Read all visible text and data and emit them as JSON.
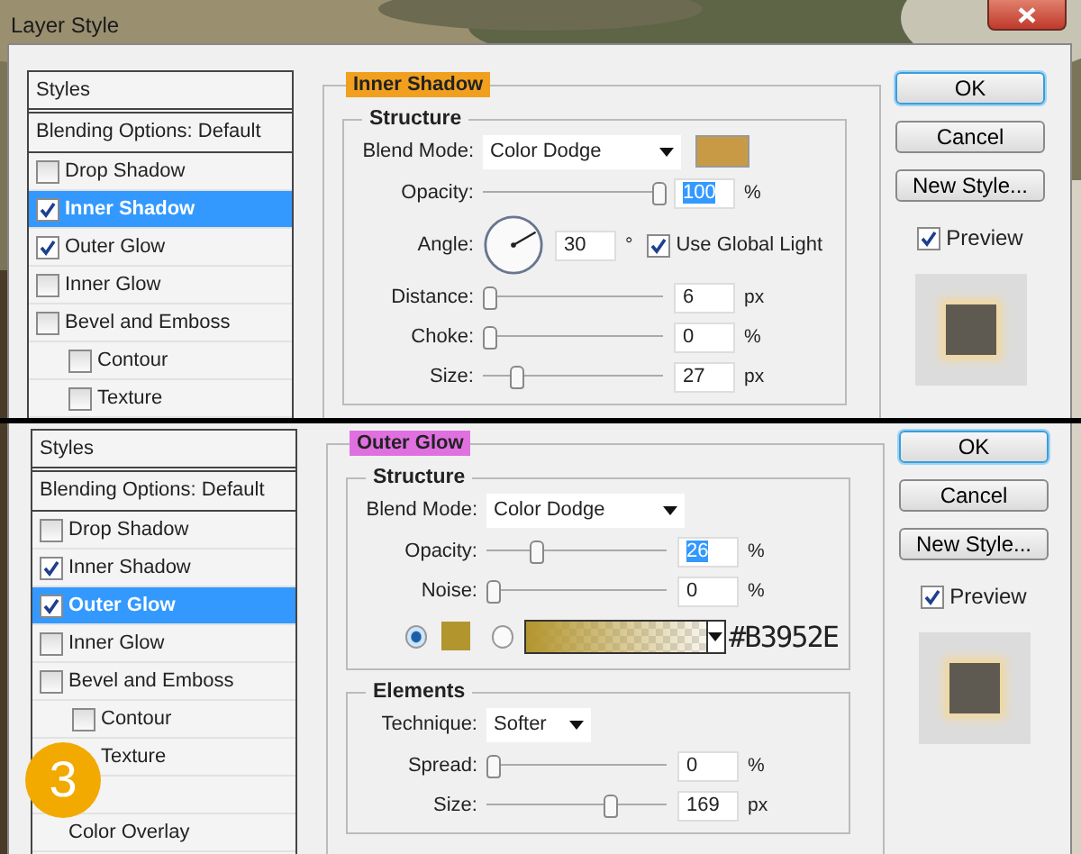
{
  "panels": [
    {
      "title": "Layer Style",
      "styles_header": "Styles",
      "blending": "Blending Options: Default",
      "styles": [
        {
          "label": "Drop Shadow",
          "checked": false,
          "selected": false
        },
        {
          "label": "Inner Shadow",
          "checked": true,
          "selected": true
        },
        {
          "label": "Outer Glow",
          "checked": true,
          "selected": false
        },
        {
          "label": "Inner Glow",
          "checked": false,
          "selected": false
        },
        {
          "label": "Bevel and Emboss",
          "checked": false,
          "selected": false,
          "children": [
            {
              "label": "Contour",
              "checked": false,
              "selected": false
            },
            {
              "label": "Texture",
              "checked": false,
              "selected": false
            }
          ]
        }
      ],
      "section": {
        "legend": "Inner Shadow",
        "color": "#f0a01e"
      },
      "groups": [
        {
          "legend": "Structure",
          "rows": [
            {
              "kind": "blend",
              "label": "Blend Mode:",
              "value": "Color Dodge",
              "swatch": true
            },
            {
              "kind": "slider",
              "label": "Opacity:",
              "level": 1,
              "value": "100",
              "text_selected": true,
              "unit": "%"
            },
            {
              "kind": "angle",
              "label": "Angle:",
              "value": "30",
              "unit": "°",
              "option": "Use Global Light",
              "checked": true
            },
            {
              "kind": "slider",
              "label": "Distance:",
              "level": 0.03,
              "value": "6",
              "text_selected": false,
              "unit": "px"
            },
            {
              "kind": "slider",
              "label": "Choke:",
              "level": 0,
              "value": "0",
              "text_selected": false,
              "unit": "%"
            },
            {
              "kind": "slider",
              "label": "Size:",
              "level": 0.18,
              "value": "27",
              "text_selected": false,
              "unit": "px"
            }
          ]
        }
      ],
      "buttons": [
        {
          "label": "OK",
          "default": true
        },
        {
          "label": "Cancel",
          "default": false
        },
        {
          "label": "New Style...",
          "default": false
        }
      ],
      "preview": {
        "label": "Preview",
        "checked": true
      }
    },
    {
      "styles_header": "Styles",
      "blending": "Blending Options: Default",
      "styles": [
        {
          "label": "Drop Shadow",
          "checked": false,
          "selected": false
        },
        {
          "label": "Inner Shadow",
          "checked": true,
          "selected": false
        },
        {
          "label": "Outer Glow",
          "checked": true,
          "selected": true
        },
        {
          "label": "Inner Glow",
          "checked": false,
          "selected": false
        },
        {
          "label": "Bevel and Emboss",
          "checked": false,
          "selected": false,
          "children": [
            {
              "label": "Contour",
              "checked": false,
              "selected": false
            },
            {
              "label": "Texture",
              "selected": false
            }
          ]
        },
        {
          "kind": "badge",
          "label": "3"
        },
        {
          "label": "Color Overlay",
          "selected": false
        }
      ],
      "section": {
        "legend": "Outer Glow",
        "color": "#e070e0"
      },
      "groups": [
        {
          "legend": "Structure",
          "rows": [
            {
              "kind": "blend",
              "label": "Blend Mode:",
              "value": "Color Dodge"
            },
            {
              "kind": "slider",
              "label": "Opacity:",
              "level": 0.27,
              "value": "26",
              "text_selected": true,
              "unit": "%"
            },
            {
              "kind": "slider",
              "label": "Noise:",
              "level": 0,
              "value": "0",
              "text_selected": false,
              "unit": "%"
            },
            {
              "kind": "color",
              "solid_selected": true,
              "color": "#b3952e",
              "hex": "#B3952E"
            }
          ]
        },
        {
          "legend": "Elements",
          "rows": [
            {
              "kind": "dropdown",
              "label": "Technique:",
              "value": "Softer"
            },
            {
              "kind": "slider",
              "label": "Spread:",
              "level": 0,
              "value": "0",
              "text_selected": false,
              "unit": "%"
            },
            {
              "kind": "slider",
              "label": "Size:",
              "level": 0.68,
              "value": "169",
              "text_selected": false,
              "unit": "px"
            }
          ]
        }
      ],
      "buttons": [
        {
          "label": "OK",
          "default": true
        },
        {
          "label": "Cancel",
          "default": false
        },
        {
          "label": "New Style...",
          "default": false
        }
      ],
      "preview": {
        "label": "Preview",
        "checked": true
      }
    }
  ]
}
